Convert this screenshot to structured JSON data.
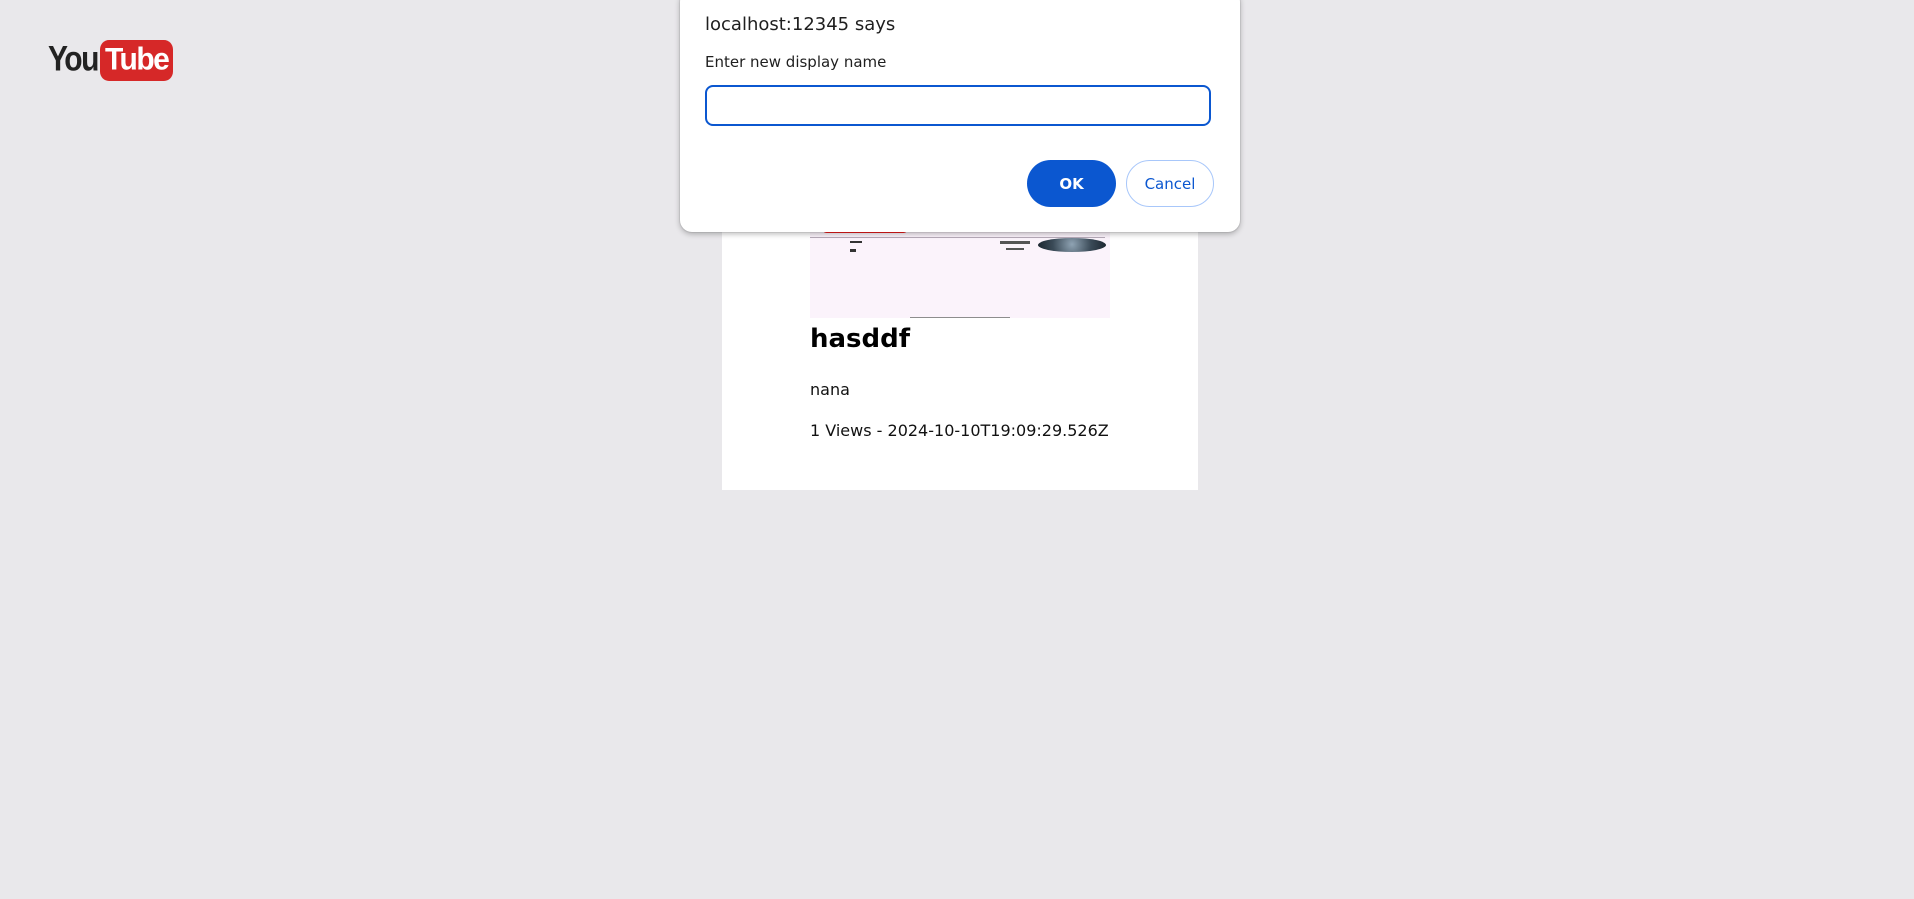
{
  "logo": {
    "part1": "You",
    "part2": "Tube",
    "accent_color": "#d62828"
  },
  "video": {
    "title": "hasddf",
    "channel": "nana",
    "meta": "1 Views - 2024-10-10T19:09:29.526Z"
  },
  "dialog": {
    "title": "localhost:12345 says",
    "message": "Enter new display name",
    "input_value": "",
    "ok_label": "OK",
    "cancel_label": "Cancel",
    "accent_color": "#0b57d0"
  }
}
